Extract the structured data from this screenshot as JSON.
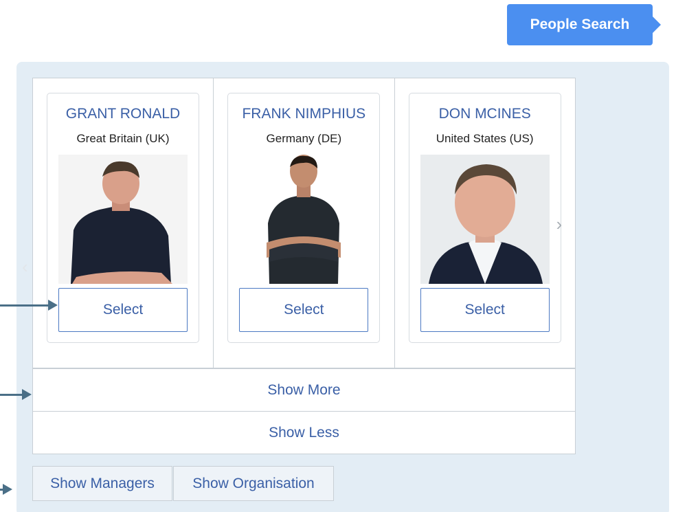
{
  "header": {
    "people_search_label": "People Search"
  },
  "people": [
    {
      "name": "GRANT RONALD",
      "country": "Great Britain (UK)",
      "select_label": "Select"
    },
    {
      "name": "FRANK NIMPHIUS",
      "country": "Germany (DE)",
      "select_label": "Select"
    },
    {
      "name": "DON MCINES",
      "country": "United States (US)",
      "select_label": "Select"
    }
  ],
  "carousel": {
    "prev_icon": "chevron-left-icon",
    "next_icon": "chevron-right-icon"
  },
  "actions": {
    "show_more": "Show More",
    "show_less": "Show Less",
    "show_managers": "Show Managers",
    "show_organisation": "Show Organisation"
  },
  "colors": {
    "accent": "#4b8ff0",
    "link_text": "#3a5fa6",
    "panel_bg": "#e3edf5",
    "annotation_arrow": "#4a6f87"
  }
}
